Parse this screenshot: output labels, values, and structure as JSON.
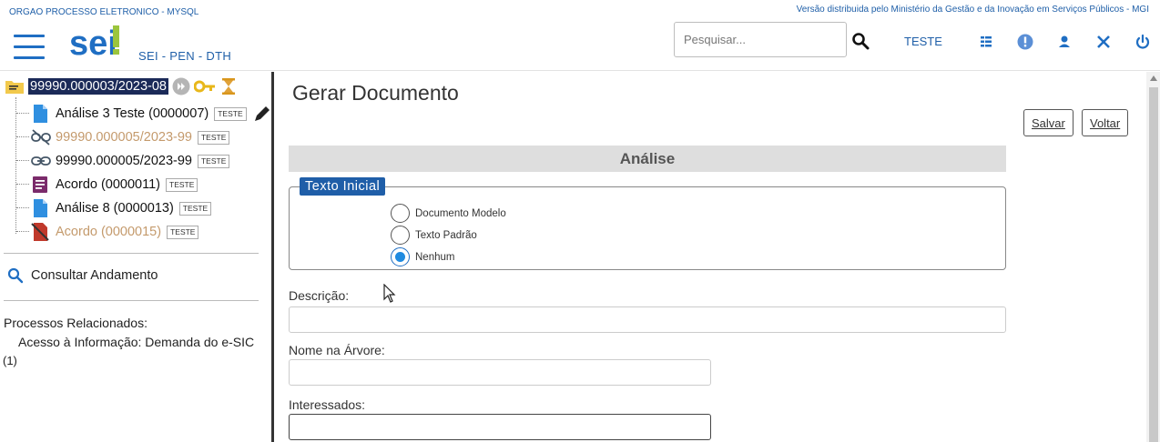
{
  "header": {
    "org": "ORGAO PROCESSO ELETRONICO - MYSQL",
    "version_text": "Versão distribuida pelo Ministério da Gestão e da Inovação em Serviços Públicos - MGI",
    "logo_text": "sei",
    "subtitle": "SEI - PEN - DTH",
    "search_placeholder": "Pesquisar...",
    "unit": "TESTE",
    "brand_color": "#1f6ec3"
  },
  "tree": {
    "root": "99990.000003/2023-08",
    "items": [
      {
        "label": "Análise 3 Teste (0000007)",
        "badge": "TESTE",
        "icon": "document-icon",
        "muted": false
      },
      {
        "label": "99990.000005/2023-99",
        "badge": "TESTE",
        "icon": "unlinked-icon",
        "muted": true
      },
      {
        "label": "99990.000005/2023-99",
        "badge": "TESTE",
        "icon": "link-icon",
        "muted": false
      },
      {
        "label": "Acordo (0000011)",
        "badge": "TESTE",
        "icon": "form-document-icon",
        "muted": false
      },
      {
        "label": "Análise 8 (0000013)",
        "badge": "TESTE",
        "icon": "document-icon",
        "muted": false
      },
      {
        "label": "Acordo (0000015)",
        "badge": "TESTE",
        "icon": "cancelled-document-icon",
        "muted": true
      }
    ]
  },
  "sidebar": {
    "consult": "Consultar Andamento",
    "related_title": "Processos Relacionados:",
    "related_item": "Acesso à Informação: Demanda do e-SIC",
    "related_count": "(1)"
  },
  "main": {
    "title": "Gerar Documento",
    "save_label": "Salvar",
    "back_label": "Voltar",
    "section": "Análise",
    "legend": "Texto Inicial",
    "radios": [
      "Documento Modelo",
      "Texto Padrão",
      "Nenhum"
    ],
    "selected_radio": "Nenhum",
    "description_label": "Descrição:",
    "tree_name_label": "Nome na Árvore:",
    "interested_label": "Interessados:"
  }
}
